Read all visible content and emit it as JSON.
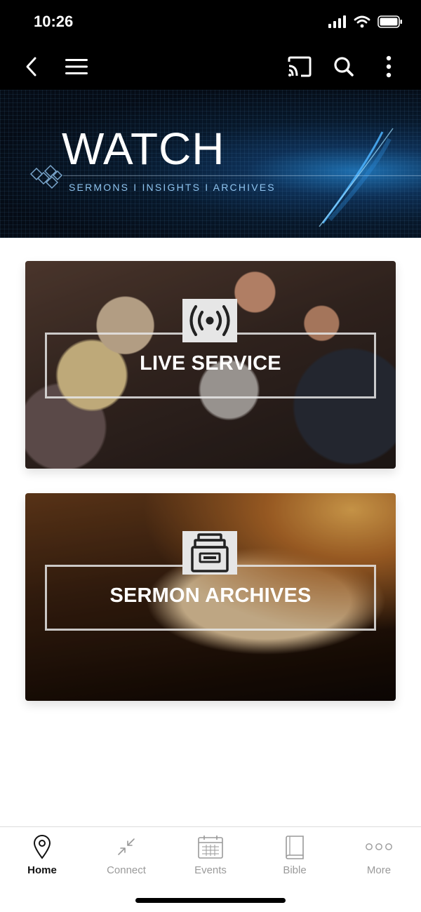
{
  "status_bar": {
    "time": "10:26"
  },
  "banner": {
    "title": "WATCH",
    "subtitle": "SERMONS  I  INSIGHTS  I  ARCHIVES"
  },
  "cards": [
    {
      "label": "LIVE SERVICE",
      "icon": "broadcast-icon"
    },
    {
      "label": "SERMON ARCHIVES",
      "icon": "archive-icon"
    }
  ],
  "tabs": [
    {
      "label": "Home",
      "icon": "location-pin-icon",
      "active": true
    },
    {
      "label": "Connect",
      "icon": "compress-arrows-icon",
      "active": false
    },
    {
      "label": "Events",
      "icon": "calendar-icon",
      "active": false
    },
    {
      "label": "Bible",
      "icon": "book-icon",
      "active": false
    },
    {
      "label": "More",
      "icon": "more-dots-icon",
      "active": false
    }
  ],
  "colors": {
    "tab_active": "#111111",
    "tab_inactive": "#9a9a9a",
    "topbar": "#000000"
  }
}
